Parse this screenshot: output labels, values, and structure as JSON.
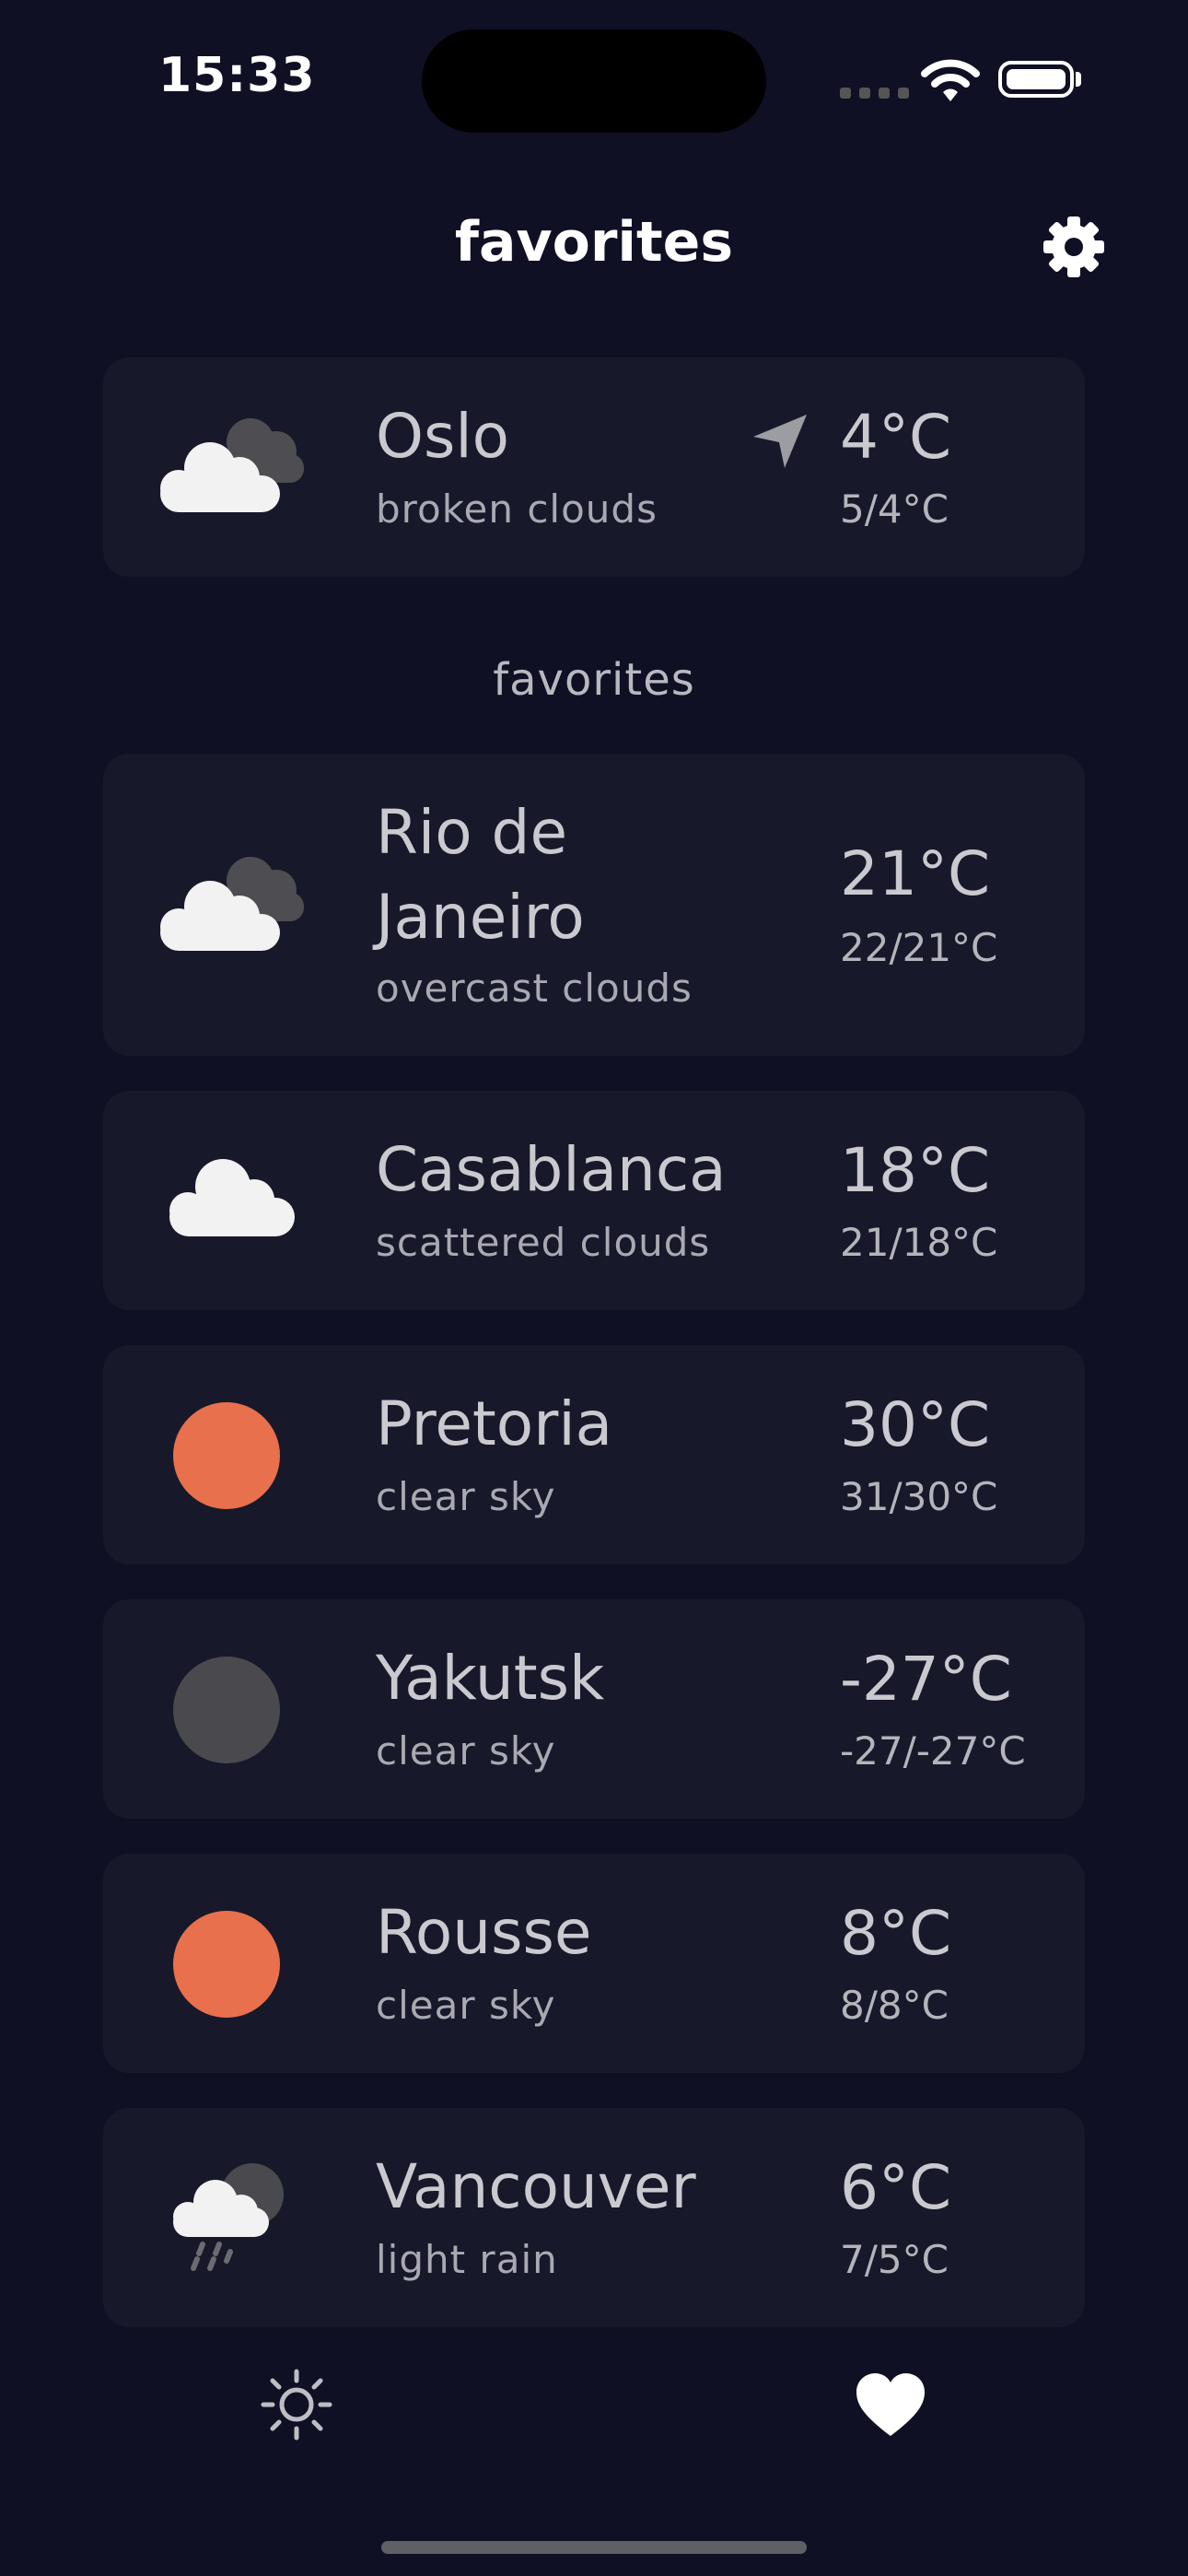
{
  "status_bar": {
    "time": "15:33"
  },
  "header": {
    "title": "favorites",
    "settings_icon": "gear-icon"
  },
  "current_location": {
    "city": "Oslo",
    "description": "broken clouds",
    "temp": "4°C",
    "range": "5/4°C",
    "icon": "broken-clouds-icon",
    "location_icon": "location-arrow-icon"
  },
  "section_label": "favorites",
  "favorites": [
    {
      "city_line1": "Rio de",
      "city_line2": "Janeiro",
      "description": "overcast clouds",
      "temp": "21°C",
      "range": "22/21°C",
      "icon": "overcast-clouds-icon"
    },
    {
      "city": "Casablanca",
      "description": "scattered clouds",
      "temp": "18°C",
      "range": "21/18°C",
      "icon": "scattered-clouds-icon"
    },
    {
      "city": "Pretoria",
      "description": "clear sky",
      "temp": "30°C",
      "range": "31/30°C",
      "icon": "sun-icon",
      "icon_color": "#e8704c"
    },
    {
      "city": "Yakutsk",
      "description": "clear sky",
      "temp": "-27°C",
      "range": "-27/-27°C",
      "icon": "moon-icon",
      "icon_color": "#4a4a4e"
    },
    {
      "city": "Rousse",
      "description": "clear sky",
      "temp": "8°C",
      "range": "8/8°C",
      "icon": "sun-icon",
      "icon_color": "#e8704c"
    },
    {
      "city": "Vancouver",
      "description": "light rain",
      "temp": "6°C",
      "range": "7/5°C",
      "icon": "light-rain-icon"
    }
  ],
  "tab_bar": {
    "weather_tab_icon": "sun-outline-icon",
    "favorites_tab_icon": "heart-icon"
  },
  "colors": {
    "background": "#0f1024",
    "card": "#171829",
    "accent_sun": "#e8704c",
    "moon": "#4a4a4e"
  }
}
